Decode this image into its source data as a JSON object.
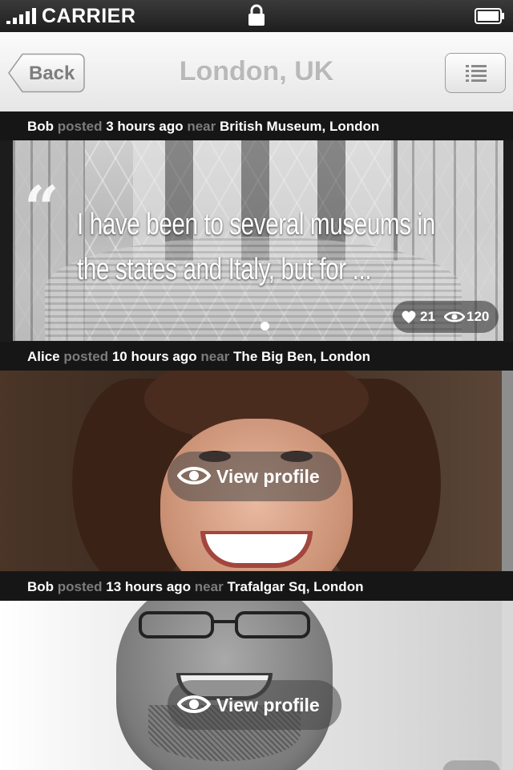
{
  "status_bar": {
    "carrier": "CARRIER"
  },
  "nav": {
    "back_label": "Back",
    "title": "London, UK"
  },
  "posts": [
    {
      "author": "Bob",
      "verb": "posted",
      "time": "3 hours ago",
      "near": "near",
      "place": "British Museum, London",
      "quote": "I have been to several museums in the states and Italy, but for ...",
      "likes": "21",
      "views": "120"
    },
    {
      "author": "Alice",
      "verb": "posted",
      "time": "10 hours ago",
      "near": "near",
      "place": "The Big Ben, London",
      "action": "View profile"
    },
    {
      "author": "Bob",
      "verb": "posted",
      "time": "13 hours ago",
      "near": "near",
      "place": "Trafalgar Sq, London",
      "action": "View profile"
    }
  ],
  "colors": {
    "header_bg": "#161616",
    "muted": "#7c7c7c",
    "nav_title": "#b9b9b9"
  },
  "icons": [
    "signal-icon",
    "lock-icon",
    "battery-icon",
    "back-arrow",
    "list-icon",
    "quote-icon",
    "heart-icon",
    "eye-icon"
  ]
}
